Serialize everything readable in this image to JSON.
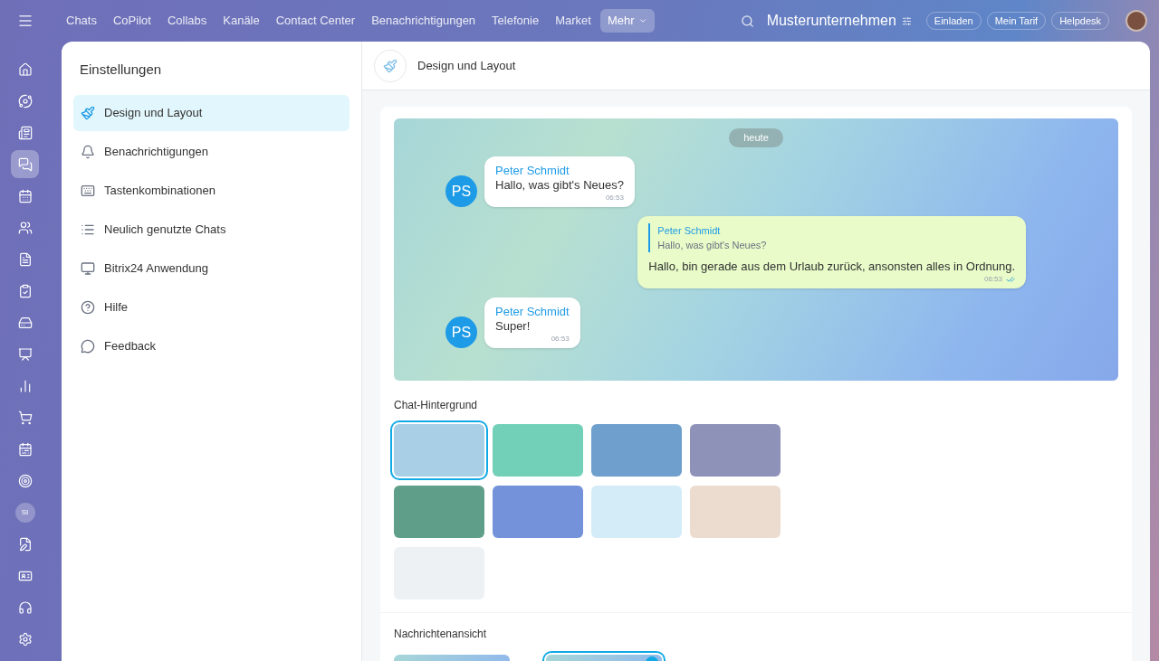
{
  "topbar": {
    "nav": [
      {
        "label": "Chats",
        "selected": false
      },
      {
        "label": "CoPilot",
        "selected": false
      },
      {
        "label": "Collabs",
        "selected": false
      },
      {
        "label": "Kanäle",
        "selected": false
      },
      {
        "label": "Contact Center",
        "selected": false
      },
      {
        "label": "Benachrichtigungen",
        "selected": false
      },
      {
        "label": "Telefonie",
        "selected": false
      },
      {
        "label": "Market",
        "selected": false
      },
      {
        "label": "Mehr",
        "selected": true
      }
    ],
    "company": "Musterunternehmen",
    "buttons": [
      "Einladen",
      "Mein Tarif",
      "Helpdesk"
    ]
  },
  "rail": [
    {
      "kind": "icon",
      "selected": false
    },
    {
      "kind": "icon",
      "selected": false
    },
    {
      "kind": "icon",
      "selected": false
    },
    {
      "kind": "icon",
      "selected": true
    },
    {
      "kind": "icon",
      "selected": false
    },
    {
      "kind": "icon",
      "selected": false
    },
    {
      "kind": "icon",
      "selected": false
    },
    {
      "kind": "icon",
      "selected": false
    },
    {
      "kind": "icon",
      "selected": false
    },
    {
      "kind": "icon",
      "selected": false
    },
    {
      "kind": "icon",
      "selected": false
    },
    {
      "kind": "icon",
      "selected": false
    },
    {
      "kind": "icon",
      "selected": false
    },
    {
      "kind": "icon",
      "selected": false
    },
    {
      "kind": "avatar",
      "label": "SI",
      "selected": false
    },
    {
      "kind": "icon",
      "selected": false
    },
    {
      "kind": "icon",
      "selected": false
    },
    {
      "kind": "icon",
      "selected": false
    },
    {
      "kind": "icon",
      "selected": false
    }
  ],
  "sidebar": {
    "title": "Einstellungen",
    "items": [
      {
        "label": "Design und Layout",
        "selected": true
      },
      {
        "label": "Benachrichtigungen",
        "selected": false
      },
      {
        "label": "Tastenkombinationen",
        "selected": false
      },
      {
        "label": "Neulich genutzte Chats",
        "selected": false
      },
      {
        "label": "Bitrix24 Anwendung",
        "selected": false
      },
      {
        "label": "Hilfe",
        "selected": false
      },
      {
        "label": "Feedback",
        "selected": false
      }
    ]
  },
  "header": {
    "title": "Design und Layout"
  },
  "preview": {
    "date": "heute",
    "messages": [
      {
        "kind": "incoming",
        "initials": "PS",
        "author": "Peter Schmidt",
        "text": "Hallo, was gibt's Neues?",
        "time": "06:53"
      },
      {
        "kind": "outgoing",
        "quote_author": "Peter Schmidt",
        "quote_text": "Hallo, was gibt's Neues?",
        "text": "Hallo, bin gerade aus dem Urlaub zurück, ansonsten alles in Ordnung.",
        "time": "06:53",
        "read": true
      },
      {
        "kind": "incoming",
        "initials": "PS",
        "author": "Peter Schmidt",
        "text": "Super!",
        "time": "06:53"
      }
    ]
  },
  "backgrounds": {
    "title": "Chat-Hintergrund",
    "items": [
      {
        "color": "#a8cfe6",
        "selected": true
      },
      {
        "color": "#72cfb8",
        "selected": false
      },
      {
        "color": "#6f9fcc",
        "selected": false
      },
      {
        "color": "#8f92b8",
        "selected": false
      },
      {
        "color": "#5f9f8a",
        "selected": false
      },
      {
        "color": "#7392da",
        "selected": false
      },
      {
        "color": "#d4ecf8",
        "selected": false
      },
      {
        "color": "#ecdcd0",
        "selected": false
      },
      {
        "color": "#eef1f3",
        "selected": false
      }
    ]
  },
  "message_views": {
    "title": "Nachrichtenansicht",
    "items": [
      {
        "selected": false
      },
      {
        "selected": true
      }
    ]
  }
}
